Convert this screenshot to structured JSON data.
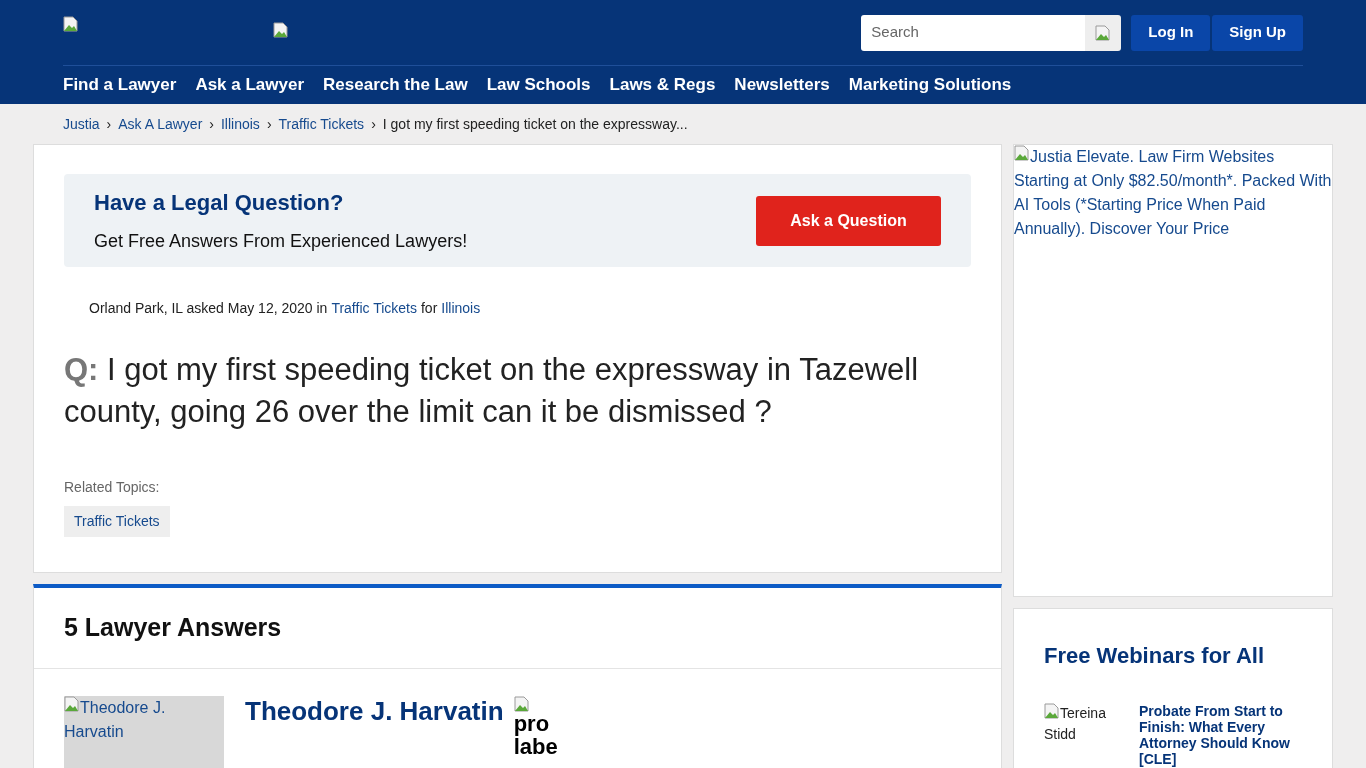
{
  "header": {
    "search": {
      "placeholder": "Search"
    },
    "buttons": [
      "Log In",
      "Sign Up"
    ],
    "nav": [
      "Find a Lawyer",
      "Ask a Lawyer",
      "Research the Law",
      "Law Schools",
      "Laws & Regs",
      "Newsletters",
      "Marketing Solutions"
    ]
  },
  "breadcrumbs": {
    "links": [
      "Justia",
      "Ask A Lawyer",
      "Illinois",
      "Traffic Tickets"
    ],
    "separator": "›",
    "current": "I got my first speeding ticket on the expressway..."
  },
  "promo": {
    "title": "Have a Legal Question?",
    "subtitle": "Get Free Answers From Experienced Lawyers!",
    "button": "Ask a Question"
  },
  "question": {
    "location": "Orland Park, IL asked May 12, 2020 in",
    "topic": "Traffic Tickets",
    "for": "for",
    "state": "Illinois",
    "prefix": "Q:",
    "text": "I got my first speeding ticket on the expressway in Tazewell county, going 26 over the limit can it be dismissed ?",
    "related_label": "Related Topics:",
    "tags": [
      "Traffic Tickets"
    ]
  },
  "answers": {
    "heading": "5 Lawyer Answers",
    "first": {
      "photo_alt": "Theodore J. Harvatin",
      "name": "Theodore J. Harvatin",
      "badge_alt": "pro labe"
    }
  },
  "sidebar": {
    "ad_alt": "Justia Elevate. Law Firm Websites Starting at Only $82.50/month*. Packed With AI Tools (*Starting Price When Paid Annually). Discover Your Price",
    "webinars": {
      "title": "Free Webinars for All",
      "items": [
        {
          "photo_alt": "Tereina Stidd",
          "title": "Probate From Start to Finish: What Every Attorney Should Know [CLE]"
        }
      ]
    }
  }
}
